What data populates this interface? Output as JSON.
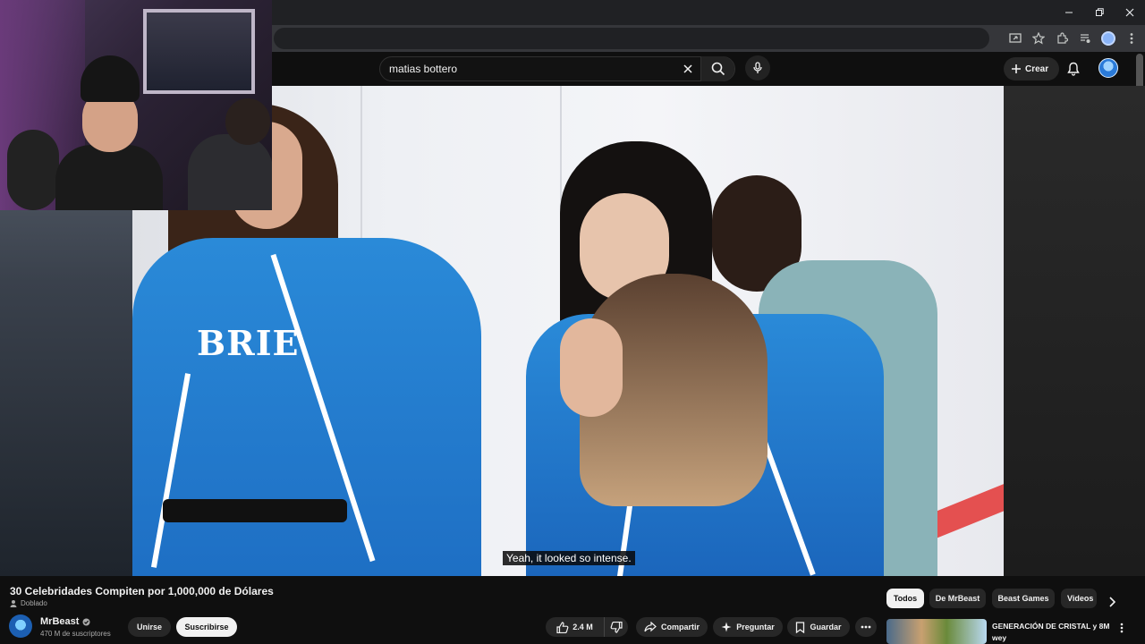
{
  "search": {
    "query": "matias bottero"
  },
  "masthead": {
    "create_label": "Crear"
  },
  "video": {
    "jersey_name": "BRIE",
    "subtitle": "Yeah, it looked so intense."
  },
  "details": {
    "title": "30 Celebridades Compiten por 1,000,000 de Dólares",
    "dubbed_label": "Doblado",
    "channel_name": "MrBeast",
    "subscribers": "470 M de suscriptores",
    "join_label": "Unirse",
    "subscribe_label": "Suscribirse",
    "likes": "2.4 M",
    "share_label": "Compartir",
    "ask_label": "Preguntar",
    "save_label": "Guardar"
  },
  "chips": [
    "Todos",
    "De MrBeast",
    "Beast Games",
    "Videos"
  ],
  "recommendation": {
    "title": "GENERACIÓN DE CRISTAL y 8M wey"
  },
  "colors": {
    "background": "#0f0f0f",
    "pill": "#272727",
    "accent_blue": "#1e6fc4"
  }
}
